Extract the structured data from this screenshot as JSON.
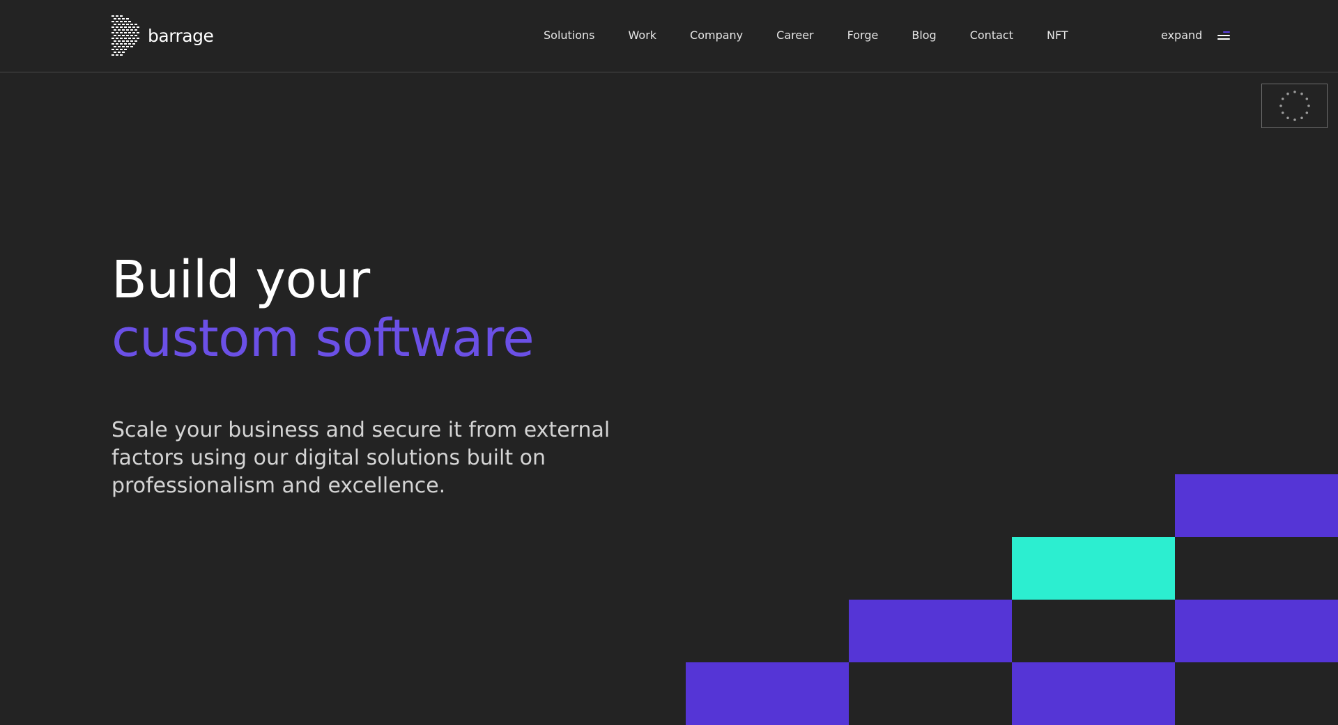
{
  "header": {
    "logo_text": "barrage",
    "nav": [
      "Solutions",
      "Work",
      "Company",
      "Career",
      "Forge",
      "Blog",
      "Contact",
      "NFT"
    ],
    "expand_label": "expand"
  },
  "hero": {
    "line1": "Build your",
    "line2": "custom software",
    "description": "Scale your business and secure it from external factors using our digital solutions built on professionalism and excellence."
  },
  "colors": {
    "background": "#232323",
    "accent_purple": "#5535d6",
    "accent_teal": "#2ceed0",
    "headline_purple": "#6b50e6"
  },
  "icons": [
    "barrage-logo-icon",
    "menu-icon",
    "eu-flag-icon"
  ]
}
